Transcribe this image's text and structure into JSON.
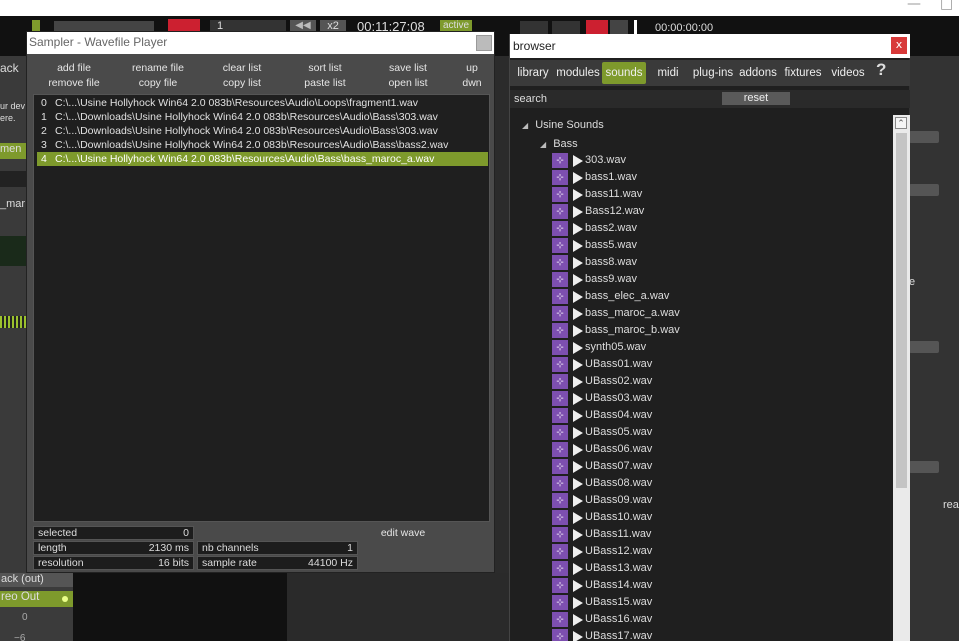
{
  "host": {
    "timecode": "00:11:27:08",
    "transport_time": "00:00:00:00",
    "active_badge": "active",
    "x2_label": "x2",
    "one_label": "1",
    "left_texts": [
      "ack",
      "ur dev",
      "ere.",
      "men",
      "_mar"
    ],
    "right_texts": [
      "e",
      "rea"
    ],
    "bottom": {
      "out_label": "ack (out)",
      "stereo_out": "reo Out",
      "zero": "0",
      "minus6": "−6"
    }
  },
  "sampler": {
    "title": "Sampler - Wavefile Player",
    "buttons": [
      {
        "top": "add file",
        "bottom": "remove file"
      },
      {
        "top": "rename file",
        "bottom": "copy file"
      },
      {
        "top": "clear list",
        "bottom": "copy list"
      },
      {
        "top": "sort list",
        "bottom": "paste list"
      },
      {
        "top": "save list",
        "bottom": "open list"
      },
      {
        "top": "up",
        "bottom": "dwn"
      }
    ],
    "files": [
      {
        "index": "0",
        "path": "C:\\...\\Usine Hollyhock Win64 2.0 083b\\Resources\\Audio\\Loops\\fragment1.wav"
      },
      {
        "index": "1",
        "path": "C:\\...\\Downloads\\Usine Hollyhock Win64 2.0 083b\\Resources\\Audio\\Bass\\303.wav"
      },
      {
        "index": "2",
        "path": "C:\\...\\Downloads\\Usine Hollyhock Win64 2.0 083b\\Resources\\Audio\\Bass\\303.wav"
      },
      {
        "index": "3",
        "path": "C:\\...\\Downloads\\Usine Hollyhock Win64 2.0 083b\\Resources\\Audio\\Bass\\bass2.wav"
      },
      {
        "index": "4",
        "path": "C:\\...\\Usine Hollyhock Win64 2.0 083b\\Resources\\Audio\\Bass\\bass_maroc_a.wav"
      }
    ],
    "selected_index": 4,
    "info": {
      "selected_label": "selected",
      "selected_value": "0",
      "length_label": "length",
      "length_value": "2130  ms",
      "resolution_label": "resolution",
      "resolution_value": "16  bits",
      "channels_label": "nb channels",
      "channels_value": "1",
      "samplerate_label": "sample rate",
      "samplerate_value": "44100  Hz",
      "edit_wave": "edit wave"
    }
  },
  "browser": {
    "title": "browser",
    "close": "x",
    "tabs": [
      "library",
      "modules",
      "sounds",
      "midi",
      "plug-ins",
      "addons",
      "fixtures",
      "videos"
    ],
    "active_tab": "sounds",
    "help": "?",
    "search_label": "search",
    "reset_label": "reset",
    "tree_root": "Usine Sounds",
    "tree_folder": "Bass",
    "wav_files": [
      "303.wav",
      "bass1.wav",
      "bass11.wav",
      "Bass12.wav",
      "bass2.wav",
      "bass5.wav",
      "bass8.wav",
      "bass9.wav",
      "bass_elec_a.wav",
      "bass_maroc_a.wav",
      "bass_maroc_b.wav",
      "synth05.wav",
      "UBass01.wav",
      "UBass02.wav",
      "UBass03.wav",
      "UBass04.wav",
      "UBass05.wav",
      "UBass06.wav",
      "UBass07.wav",
      "UBass08.wav",
      "UBass09.wav",
      "UBass10.wav",
      "UBass11.wav",
      "UBass12.wav",
      "UBass13.wav",
      "UBass14.wav",
      "UBass15.wav",
      "UBass16.wav",
      "UBass17.wav"
    ]
  },
  "colors": {
    "accent": "#7e9a2c",
    "wav_icon": "#7d4fb0",
    "close_red": "#d83a3a"
  }
}
